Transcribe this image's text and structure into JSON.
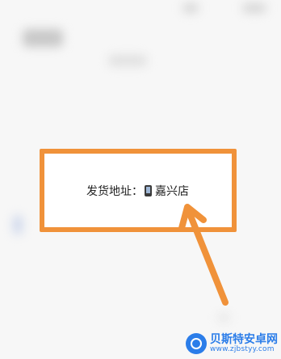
{
  "address": {
    "label": "发货地址：",
    "phone_icon": "mobile-phone-icon",
    "value": "嘉兴店"
  },
  "annotation": {
    "highlight_color": "#f0923a",
    "arrow_color": "#f0923a"
  },
  "watermark": {
    "title": "贝斯特安卓网",
    "url": "www.zjbstyy.com",
    "brand_color": "#2b7de9"
  }
}
